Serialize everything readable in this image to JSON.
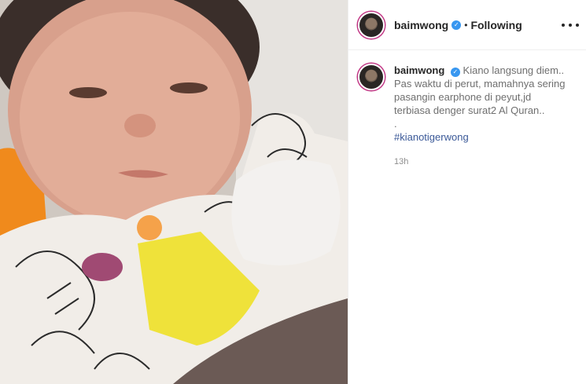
{
  "header": {
    "username": "baimwong",
    "verified_glyph": "✓",
    "separator": "•",
    "follow_status": "Following",
    "more_icon": "more-horizontal-icon"
  },
  "caption": {
    "username": "baimwong",
    "verified_glyph": "✓",
    "first_line": "Kiano langsung diem..",
    "lines": [
      "Pas waktu di perut, mamahnya sering",
      "pasangin earphone di peyut,jd",
      "terbiasa denger surat2 Al Quran..",
      "."
    ],
    "hashtag": "#kianotigerwong",
    "time_ago": "13h"
  },
  "media": {
    "description_icon": "photo-video-icon"
  },
  "colors": {
    "accent": "#3897f0",
    "hashtag": "#3b5998",
    "text": "#262626",
    "muted": "#8e8e8e",
    "border": "#efefef"
  }
}
